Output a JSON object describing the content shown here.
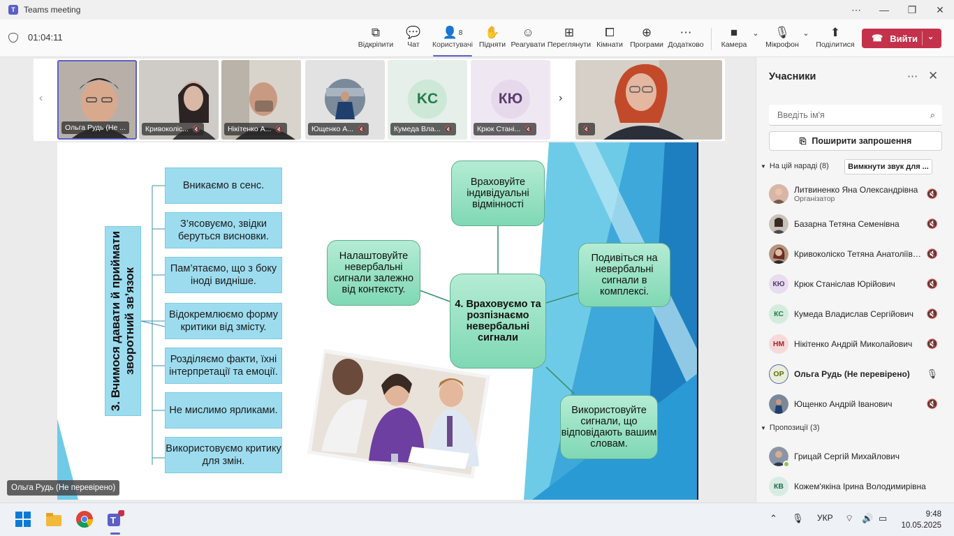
{
  "window": {
    "title": "Teams meeting"
  },
  "toolbar": {
    "timer": "01:04:11",
    "buttons": [
      {
        "label": "Відкріпити",
        "icon": "unpin-icon"
      },
      {
        "label": "Чат",
        "icon": "chat-icon"
      },
      {
        "label": "Користувачі",
        "icon": "people-icon",
        "badge": "8"
      },
      {
        "label": "Підняти",
        "icon": "raise-hand-icon"
      },
      {
        "label": "Реагувати",
        "icon": "react-icon"
      },
      {
        "label": "Переглянути",
        "icon": "view-icon"
      },
      {
        "label": "Кімнати",
        "icon": "rooms-icon"
      },
      {
        "label": "Програми",
        "icon": "apps-icon"
      },
      {
        "label": "Додатково",
        "icon": "more-icon"
      },
      {
        "label": "Камера",
        "icon": "camera-icon"
      },
      {
        "label": "Мікрофон",
        "icon": "mic-off-icon"
      },
      {
        "label": "Поділитися",
        "icon": "share-icon"
      }
    ],
    "leave_label": "Вийти"
  },
  "gallery": {
    "tiles": [
      {
        "name": "Ольга Рудь (Не ..."
      },
      {
        "name": "Кривоколіс..."
      },
      {
        "name": "Нікітенко А..."
      },
      {
        "name": "Ющенко А..."
      },
      {
        "name": "Кумеда Вла...",
        "initials": "KC"
      },
      {
        "name": "Крюк Стані...",
        "initials": "КЮ"
      },
      {
        "name": ""
      }
    ]
  },
  "slide": {
    "vertical_title": "3. Вчимося давати й приймати зворотний зв’язок",
    "left_items": [
      "Вникаємо в сенс.",
      "З’ясовуємо, звідки беруться висновки.",
      "Пам’ятаємо, що з боку іноді видніше.",
      "Відокремлюємо форму критики від змісту.",
      "Розділяємо факти, їхні інтерпретації та емоції.",
      "Не мислимо ярликами.",
      "Використовуємо критику для змін."
    ],
    "center": "4. Враховуємо та розпізнаємо невербальні сигнали",
    "top": "Враховуйте індивідуальні відмінності",
    "left": "Налаштовуйте невербальні сигнали залежно від контексту.",
    "right": "Подивіться на невербальні сигнали в комплексі.",
    "bottom": "Використовуйте сигнали, що відповідають вашим словам."
  },
  "presenter_label": "Ольга Рудь (Не перевірено)",
  "panel": {
    "title": "Учасники",
    "search_placeholder": "Введіть ім'я",
    "invite_label": "Поширити запрошення",
    "in_meeting_label": "На цій нараді (8)",
    "mute_all_label": "Вимкнути звук для ...",
    "participants": [
      {
        "name": "Литвиненко Яна Олександрівна",
        "role": "Організатор",
        "avatar": "photo",
        "muted": true
      },
      {
        "name": "Базарна Тетяна Семенівна",
        "avatar": "photo",
        "muted": true
      },
      {
        "name": "Кривоколіско Тетяна Анатоліївна",
        "avatar": "photo",
        "muted": true
      },
      {
        "name": "Крюк Станіслав Юрійович",
        "initials": "КЮ",
        "muted": true
      },
      {
        "name": "Кумеда Владислав Сергійович",
        "initials": "КС",
        "muted": true
      },
      {
        "name": "Нікітенко Андрій Миколайович",
        "initials": "НМ",
        "muted": true
      },
      {
        "name": "Ольга Рудь (Не перевірено)",
        "initials": "ОР",
        "muted": false
      },
      {
        "name": "Ющенко Андрій Іванович",
        "avatar": "photo",
        "muted": true
      }
    ],
    "suggestions_label": "Пропозиції (3)",
    "suggestions": [
      {
        "name": "Грицай Сергій Михайлович",
        "avatar": "photo"
      },
      {
        "name": "Кожем'якіна Ірина Володимирівна",
        "initials": "КВ"
      }
    ]
  },
  "taskbar": {
    "language": "УКР",
    "time": "9:48",
    "date": "10.05.2025"
  }
}
